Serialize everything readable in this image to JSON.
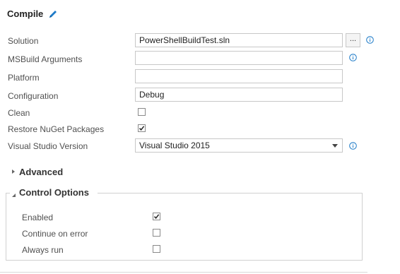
{
  "header": {
    "title": "Compile",
    "edit_icon": "pencil-icon"
  },
  "fields": {
    "solution": {
      "label": "Solution",
      "value": "PowerShellBuildTest.sln",
      "browse_label": "..."
    },
    "msbuild_arguments": {
      "label": "MSBuild Arguments",
      "value": ""
    },
    "platform": {
      "label": "Platform",
      "value": ""
    },
    "configuration": {
      "label": "Configuration",
      "value": "Debug"
    },
    "clean": {
      "label": "Clean",
      "checked": false
    },
    "restore_nuget": {
      "label": "Restore NuGet Packages",
      "checked": true
    },
    "vs_version": {
      "label": "Visual Studio Version",
      "value": "Visual Studio 2015"
    }
  },
  "sections": {
    "advanced": {
      "label": "Advanced",
      "expanded": false
    },
    "control_options": {
      "label": "Control Options",
      "expanded": true,
      "enabled": {
        "label": "Enabled",
        "checked": true
      },
      "continue_on_error": {
        "label": "Continue on error",
        "checked": false
      },
      "always_run": {
        "label": "Always run",
        "checked": false
      }
    }
  },
  "colors": {
    "accent": "#1e7bc8",
    "border": "#c8c8c8",
    "label": "#505050"
  }
}
